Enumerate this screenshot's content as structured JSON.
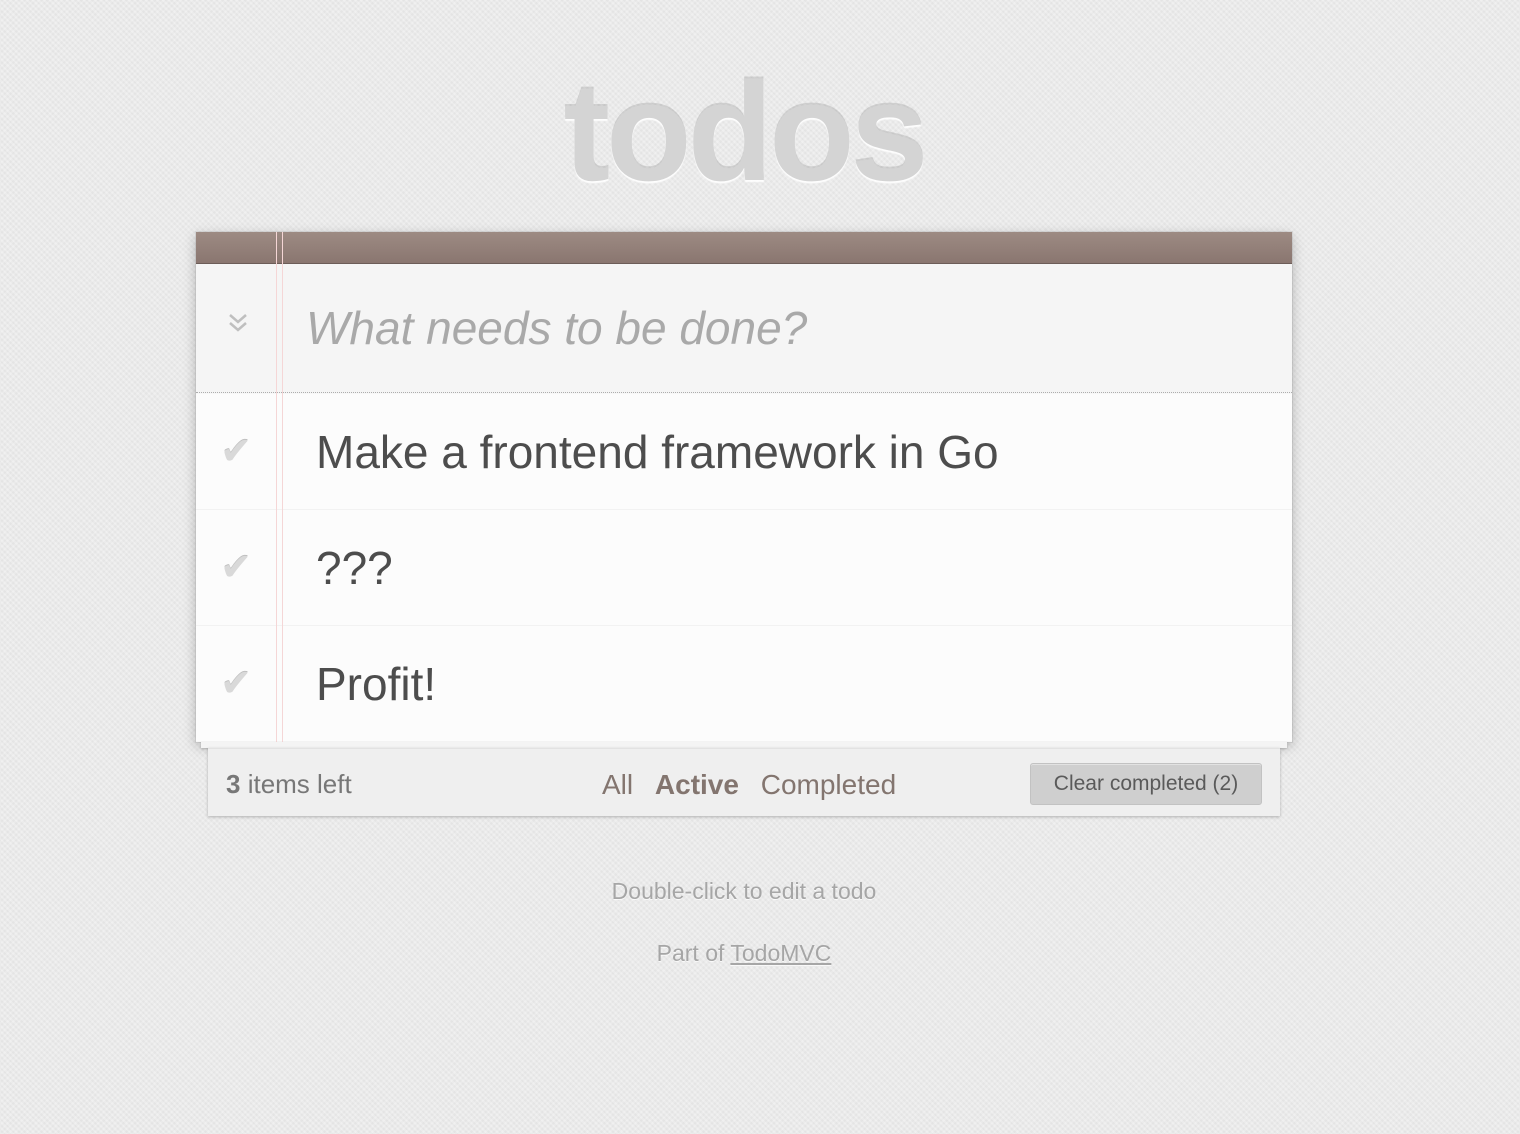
{
  "header": {
    "title": "todos"
  },
  "new_todo": {
    "placeholder": "What needs to be done?",
    "value": "",
    "toggle_all_icon": "chevron-double-down"
  },
  "todos": [
    {
      "label": "Make a frontend framework in Go",
      "completed": false
    },
    {
      "label": "???",
      "completed": false
    },
    {
      "label": "Profit!",
      "completed": false
    }
  ],
  "footer": {
    "count": "3",
    "count_suffix": " items left",
    "filters": [
      {
        "label": "All",
        "selected": false
      },
      {
        "label": "Active",
        "selected": true
      },
      {
        "label": "Completed",
        "selected": false
      }
    ],
    "clear_label": "Clear completed (2)"
  },
  "info": {
    "hint": "Double-click to edit a todo",
    "part_of_prefix": "Part of ",
    "part_of_link": "TodoMVC"
  },
  "colors": {
    "topbar": "#8a7670",
    "filter_link": "#83756f",
    "margin_line": "#f5d6d6",
    "title": "#d4d4d4"
  }
}
